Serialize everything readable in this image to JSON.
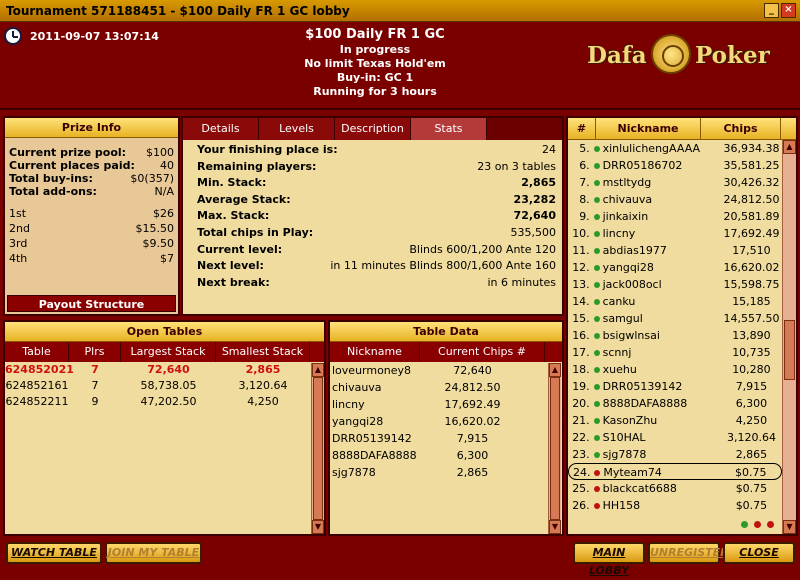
{
  "window": {
    "title": "Tournament 571188451 - $100 Daily FR 1 GC lobby",
    "minimize": "_",
    "close": "×"
  },
  "header": {
    "datetime": "2011-09-07 13:07:14",
    "name": "$100 Daily FR 1 GC",
    "status": "In progress",
    "game": "No limit Texas Hold'em",
    "buyin": "Buy-in: GC 1",
    "running": "Running for 3 hours",
    "logo_left": "Dafa",
    "logo_right": "Poker"
  },
  "prize": {
    "title": "Prize Info",
    "rows": [
      {
        "label": "Current prize pool:",
        "value": "$100"
      },
      {
        "label": "Current places paid:",
        "value": "40"
      },
      {
        "label": "Total buy-ins:",
        "value": "$0(357)"
      },
      {
        "label": "Total add-ons:",
        "value": "N/A"
      }
    ],
    "places": [
      {
        "place": "1st",
        "amount": "$26"
      },
      {
        "place": "2nd",
        "amount": "$15.50"
      },
      {
        "place": "3rd",
        "amount": "$9.50"
      },
      {
        "place": "4th",
        "amount": "$7"
      }
    ],
    "payout_button": "Payout Structure"
  },
  "tabs": [
    "Details",
    "Levels",
    "Description",
    "Stats"
  ],
  "stats": [
    {
      "key": "Your finishing place is:",
      "value": "24"
    },
    {
      "key": "Remaining players:",
      "value": "23 on 3 tables"
    },
    {
      "key": "Min. Stack:",
      "value": "2,865"
    },
    {
      "key": "Average Stack:",
      "value": "23,282"
    },
    {
      "key": "Max. Stack:",
      "value": "72,640"
    },
    {
      "key": "Total chips in Play:",
      "value": "535,500"
    },
    {
      "key": "Current level:",
      "value": "Blinds 600/1,200 Ante 120"
    },
    {
      "key": "Next level:",
      "value": "in 11 minutes Blinds 800/1,600 Ante 160"
    },
    {
      "key": "Next break:",
      "value": "in 6 minutes"
    }
  ],
  "players": {
    "headers": [
      "#",
      "Nickname",
      "Chips"
    ],
    "rows": [
      {
        "n": "5.",
        "nick": "xinlulichengAAAA",
        "chips": "36,934.38"
      },
      {
        "n": "6.",
        "nick": "DRR05186702",
        "chips": "35,581.25"
      },
      {
        "n": "7.",
        "nick": "mstltydg",
        "chips": "30,426.32"
      },
      {
        "n": "8.",
        "nick": "chivauva",
        "chips": "24,812.50"
      },
      {
        "n": "9.",
        "nick": "jinkaixin",
        "chips": "20,581.89"
      },
      {
        "n": "10.",
        "nick": "lincny",
        "chips": "17,692.49"
      },
      {
        "n": "11.",
        "nick": "abdias1977",
        "chips": "17,510"
      },
      {
        "n": "12.",
        "nick": "yangqi28",
        "chips": "16,620.02"
      },
      {
        "n": "13.",
        "nick": "jack008ocl",
        "chips": "15,598.75"
      },
      {
        "n": "14.",
        "nick": "canku",
        "chips": "15,185"
      },
      {
        "n": "15.",
        "nick": "samgul",
        "chips": "14,557.50"
      },
      {
        "n": "16.",
        "nick": "bsigwlnsai",
        "chips": "13,890"
      },
      {
        "n": "17.",
        "nick": "scnnj",
        "chips": "10,735"
      },
      {
        "n": "18.",
        "nick": "xuehu",
        "chips": "10,280"
      },
      {
        "n": "19.",
        "nick": "DRR05139142",
        "chips": "7,915"
      },
      {
        "n": "20.",
        "nick": "8888DAFA8888",
        "chips": "6,300"
      },
      {
        "n": "21.",
        "nick": "KasonZhu",
        "chips": "4,250"
      },
      {
        "n": "22.",
        "nick": "S10HAL",
        "chips": "3,120.64"
      },
      {
        "n": "23.",
        "nick": "sjg7878",
        "chips": "2,865"
      },
      {
        "n": "24.",
        "nick": "Myteam74",
        "chips": "$0.75"
      },
      {
        "n": "25.",
        "nick": "blackcat6688",
        "chips": "$0.75"
      },
      {
        "n": "26.",
        "nick": "HH158",
        "chips": "$0.75"
      }
    ]
  },
  "open_tables": {
    "title": "Open Tables",
    "headers": [
      "Table",
      "Plrs",
      "Largest Stack",
      "Smallest Stack"
    ],
    "rows": [
      [
        "624852021",
        "7",
        "72,640",
        "2,865"
      ],
      [
        "624852161",
        "7",
        "58,738.05",
        "3,120.64"
      ],
      [
        "624852211",
        "9",
        "47,202.50",
        "4,250"
      ]
    ]
  },
  "table_data": {
    "title": "Table Data",
    "headers": [
      "Nickname",
      "Current Chips #"
    ],
    "rows": [
      [
        "loveurmoney8",
        "72,640"
      ],
      [
        "chivauva",
        "24,812.50"
      ],
      [
        "lincny",
        "17,692.49"
      ],
      [
        "yangqi28",
        "16,620.02"
      ],
      [
        "DRR05139142",
        "7,915"
      ],
      [
        "8888DAFA8888",
        "6,300"
      ],
      [
        "sjg7878",
        "2,865"
      ]
    ]
  },
  "footer": {
    "watch": "WATCH TABLE",
    "join": "JOIN MY TABLE",
    "main_lobby": "MAIN LOBBY",
    "unregister": "UNREGISTER",
    "close": "CLOSE"
  }
}
